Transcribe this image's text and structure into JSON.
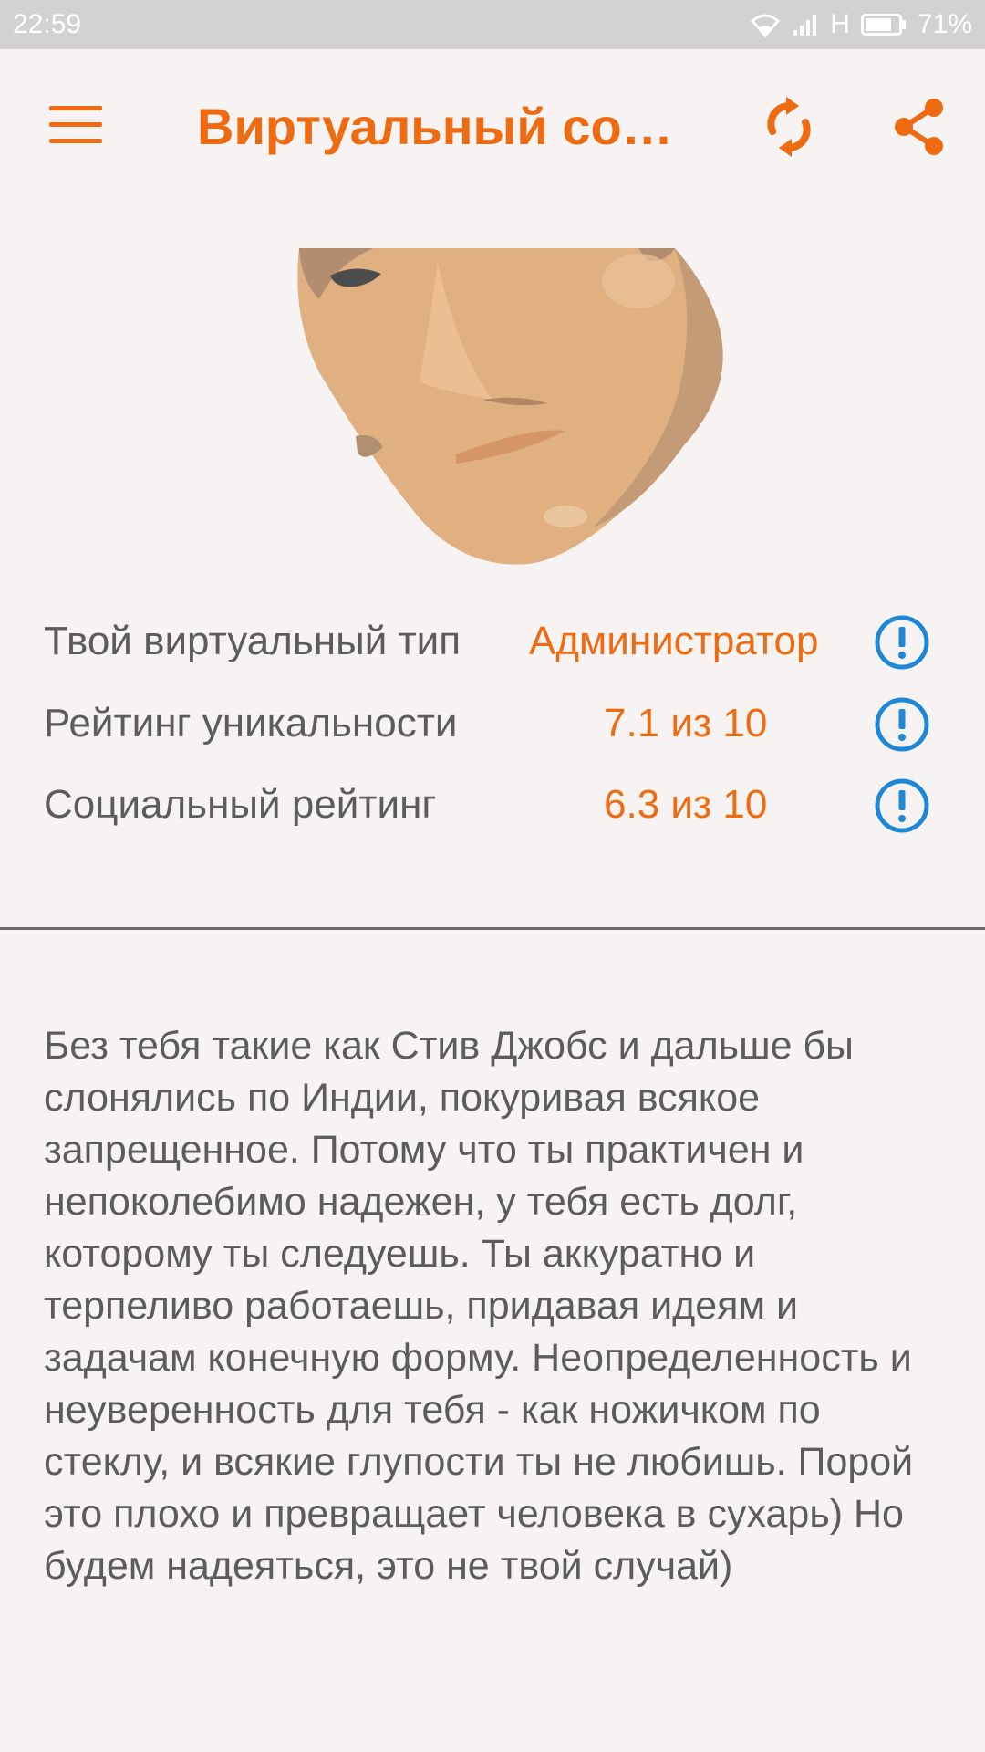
{
  "status_bar": {
    "time": "22:59",
    "network": "H",
    "battery": "71%"
  },
  "app_bar": {
    "title": "Виртуальный соц...",
    "icons": [
      "menu-icon",
      "refresh-icon",
      "share-icon"
    ],
    "accent_color": "#ee6b12"
  },
  "results": [
    {
      "label": "Твой виртуальный тип",
      "value": "Администратор"
    },
    {
      "label": "Рейтинг уникальности",
      "value": "7.1 из 10"
    },
    {
      "label": "Социальный рейтинг",
      "value": "6.3 из 10"
    }
  ],
  "info_icon_color": "#1e88d6",
  "description": "Без тебя такие как Стив Джобс и дальше бы слонялись по Индии, покуривая всякое запрещенное. Потому что ты практичен и непоколебимо надежен, у тебя есть долг, которому ты следуешь. Ты аккуратно и терпеливо работаешь, придавая идеям и задачам конечную форму. Неопределенность и неуверенность для тебя - как ножичком по стеклу, и всякие глупости ты не любишь. Порой это плохо и превращает человека в сухарь) Но будем надеяться, это не твой случай)"
}
